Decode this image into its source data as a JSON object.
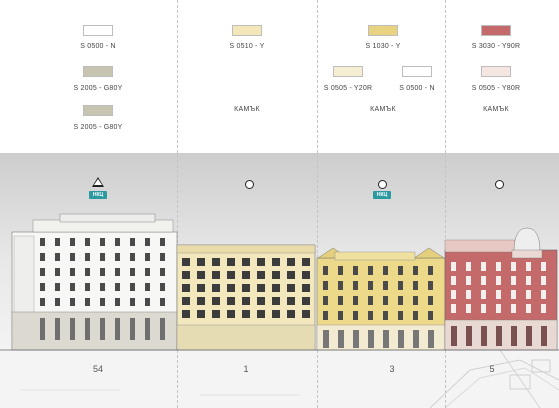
{
  "columns": [
    {
      "id": "54",
      "swatches": [
        {
          "code": "S 0500 - N",
          "color": "#ffffff"
        },
        {
          "code": "S 2005 - G80Y",
          "color": "#c8c4b2"
        },
        {
          "code": "S 2005 - G80Y",
          "color": "#c8c4b2"
        }
      ],
      "material": "",
      "marker": "triangle",
      "badge": "НКЦ",
      "number": "54"
    },
    {
      "id": "1",
      "swatches": [
        {
          "code": "S 0510 - Y",
          "color": "#f3e6b8"
        }
      ],
      "material": "КАМЪК",
      "marker": "circle",
      "badge": "",
      "number": "1"
    },
    {
      "id": "3",
      "swatches": [
        {
          "code": "S 1030 - Y",
          "color": "#e8d383"
        },
        {
          "code": "S 0505 - Y20R",
          "color": "#f6eed2"
        },
        {
          "code": "S 0500 - N",
          "color": "#ffffff"
        }
      ],
      "material": "КАМЪК",
      "marker": "circle",
      "badge": "НКЦ",
      "number": "3"
    },
    {
      "id": "5",
      "swatches": [
        {
          "code": "S 3030 - Y90R",
          "color": "#c46a6a"
        },
        {
          "code": "S 0505 - Y80R",
          "color": "#f5e6e1"
        }
      ],
      "material": "КАМЪК",
      "marker": "circle",
      "badge": "",
      "number": "5"
    }
  ],
  "colors": {
    "building_54": "#f7f7f5",
    "building_54_base": "#dcdad0",
    "building_1": "#f2e7bd",
    "building_3": "#ecd98a",
    "building_5": "#c46a6a",
    "badge": "#2a9aa0"
  }
}
